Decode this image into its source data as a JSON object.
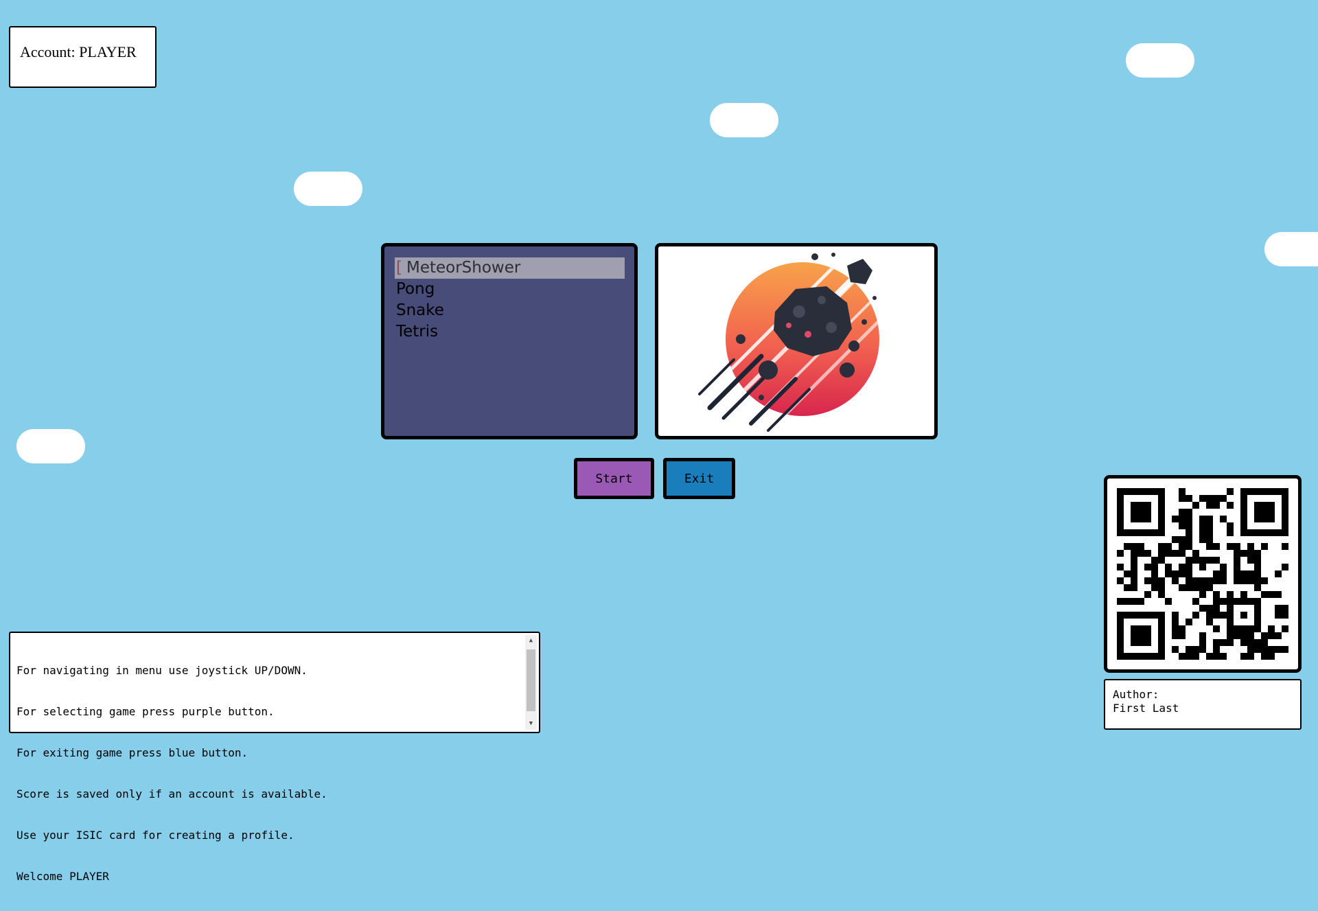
{
  "account": {
    "label": "Account: PLAYER"
  },
  "games": {
    "items": [
      "MeteorShower",
      "Pong",
      "Snake",
      "Tetris"
    ],
    "selected_index": 0,
    "cursor_glyph": "["
  },
  "preview": {
    "icon": "meteor-shower-artwork"
  },
  "buttons": {
    "start": "Start",
    "exit": "Exit"
  },
  "help": {
    "lines": [
      "For navigating in menu use joystick UP/DOWN.",
      "For selecting game press purple button.",
      "For exiting game press blue button.",
      "Score is saved only if an account is available.",
      "Use your ISIC card for creating a profile.",
      "Welcome PLAYER"
    ]
  },
  "author": {
    "label": "Author:",
    "name": "First Last"
  },
  "colors": {
    "sky": "#87ceeb",
    "list_bg": "#474c78",
    "selected_bg": "#9f9fb0",
    "start_button": "#9b59b6",
    "exit_button": "#1a7ebd"
  }
}
